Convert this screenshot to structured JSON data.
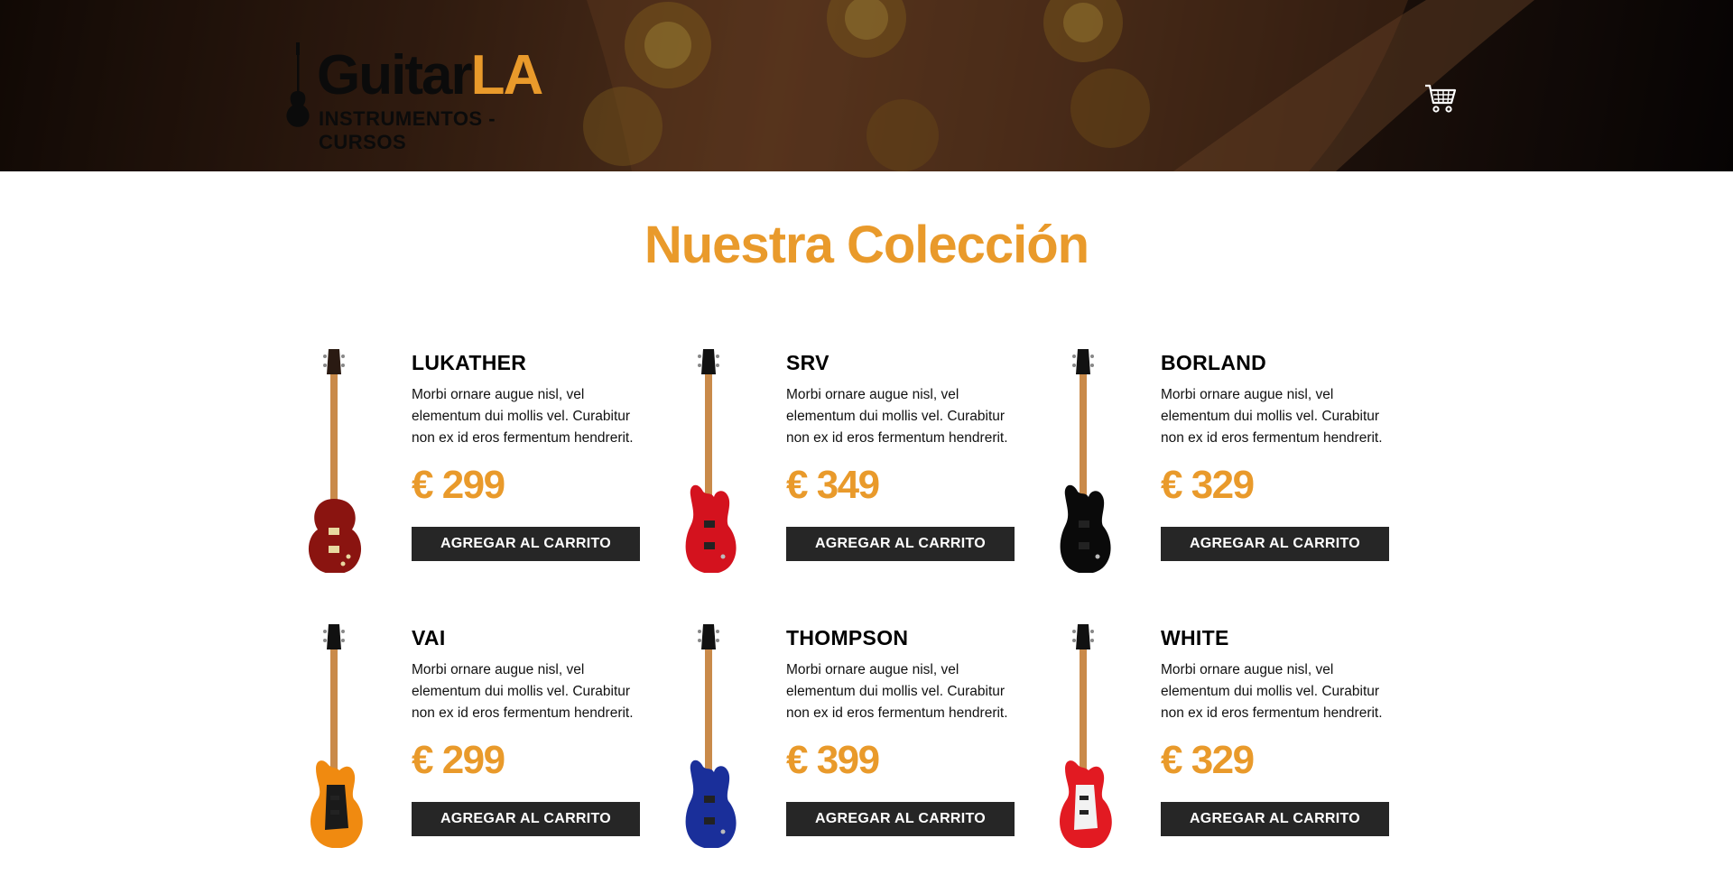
{
  "header": {
    "logo": {
      "word_main": "Guitar",
      "word_accent": "LA",
      "subtitle": "INSTRUMENTOS - CURSOS"
    },
    "cart_icon": "shopping-cart-icon"
  },
  "main": {
    "title": "Nuestra Colección",
    "products": [
      {
        "name": "LUKATHER",
        "description": "Morbi ornare augue nisl, vel elementum dui mollis vel. Curabitur non ex id eros fermentum hendrerit.",
        "price": "€ 299",
        "button": "AGREGAR AL CARRITO",
        "body_color": "#8a1410",
        "style": "lespaul"
      },
      {
        "name": "SRV",
        "description": "Morbi ornare augue nisl, vel elementum dui mollis vel. Curabitur non ex id eros fermentum hendrerit.",
        "price": "€ 349",
        "button": "AGREGAR AL CARRITO",
        "body_color": "#d4121e",
        "style": "superstrat"
      },
      {
        "name": "BORLAND",
        "description": "Morbi ornare augue nisl, vel elementum dui mollis vel. Curabitur non ex id eros fermentum hendrerit.",
        "price": "€ 329",
        "button": "AGREGAR AL CARRITO",
        "body_color": "#0a0a0a",
        "style": "superstrat"
      },
      {
        "name": "VAI",
        "description": "Morbi ornare augue nisl, vel elementum dui mollis vel. Curabitur non ex id eros fermentum hendrerit.",
        "price": "€ 299",
        "button": "AGREGAR AL CARRITO",
        "body_color": "#f08a10",
        "style": "strat"
      },
      {
        "name": "THOMPSON",
        "description": "Morbi ornare augue nisl, vel elementum dui mollis vel. Curabitur non ex id eros fermentum hendrerit.",
        "price": "€ 399",
        "button": "AGREGAR AL CARRITO",
        "body_color": "#1a2f9a",
        "style": "superstrat"
      },
      {
        "name": "WHITE",
        "description": "Morbi ornare augue nisl, vel elementum dui mollis vel. Curabitur non ex id eros fermentum hendrerit.",
        "price": "€ 329",
        "button": "AGREGAR AL CARRITO",
        "body_color": "#e21a22",
        "style": "strat"
      }
    ]
  },
  "colors": {
    "accent": "#e99a2b",
    "button_bg": "#262626",
    "text": "#111111"
  }
}
